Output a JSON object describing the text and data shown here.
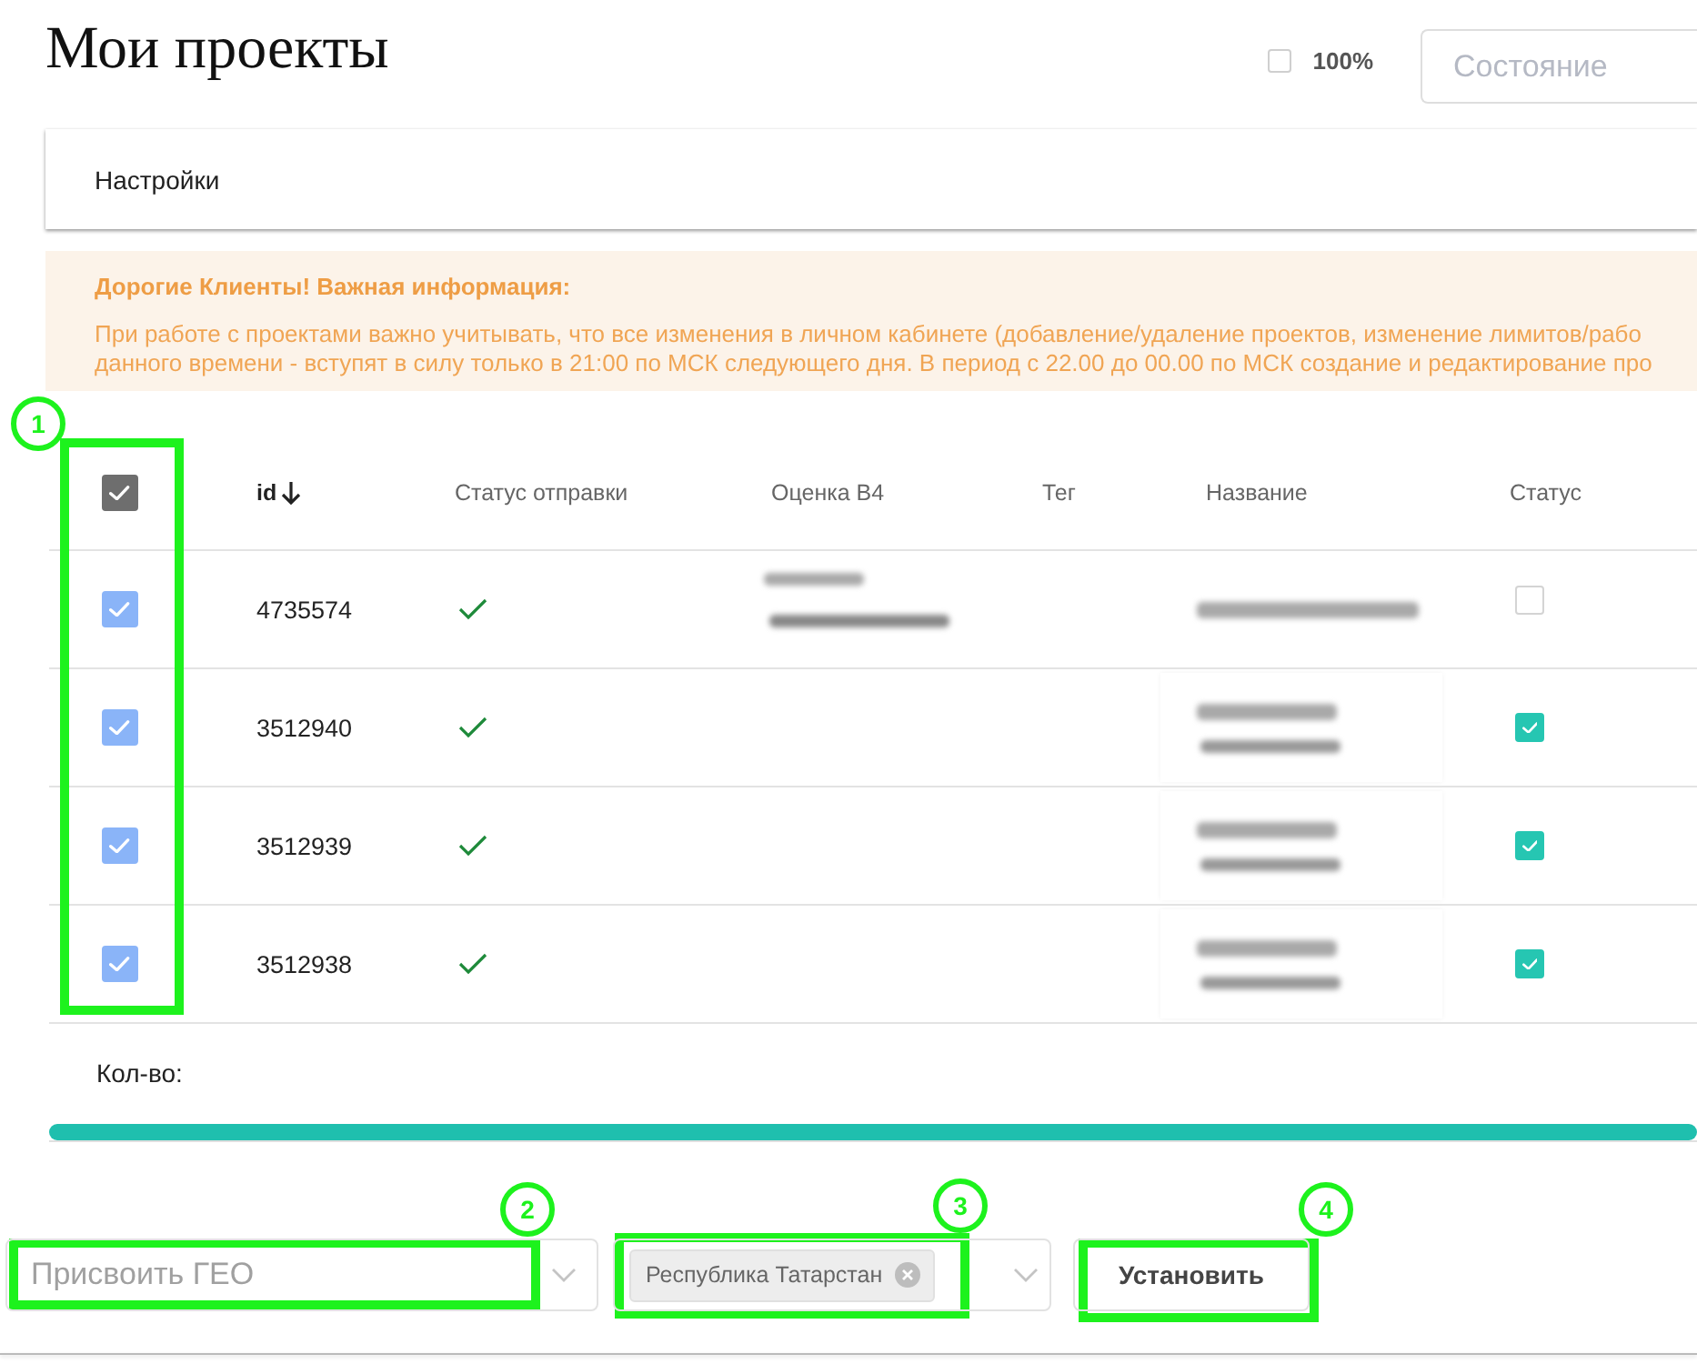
{
  "page": {
    "title": "Мои проекты"
  },
  "toolbar": {
    "full_percent": {
      "label": "100%",
      "checked": false
    },
    "state_select": {
      "placeholder": "Состояние"
    }
  },
  "settings_panel": {
    "title": "Настройки"
  },
  "notice": {
    "title": "Дорогие Клиенты! Важная информация:",
    "lines": [
      "При работе с проектами важно учитывать, что все изменения в личном кабинете (добавление/удаление проектов, изменение лимитов/рабо",
      "данного времени - вступят в силу только в 21:00 по МСК следующего дня. В период с 22.00 до 00.00 по МСК создание и редактирование про"
    ]
  },
  "table": {
    "callout": "1",
    "select_all": {
      "checked": true
    },
    "columns": [
      {
        "label": "id",
        "sorted": true
      },
      {
        "label": "Статус отправки",
        "sorted": false
      },
      {
        "label": "Оценка В4",
        "sorted": false
      },
      {
        "label": "Тег",
        "sorted": false
      },
      {
        "label": "Название",
        "sorted": false
      },
      {
        "label": "Статус",
        "sorted": false
      }
    ],
    "rows": [
      {
        "kind": "rated",
        "selected": true,
        "id": "4735574",
        "sent": true,
        "active": false
      },
      {
        "kind": "unrated",
        "selected": true,
        "id": "3512940",
        "sent": true,
        "active": true
      },
      {
        "kind": "unrated",
        "selected": true,
        "id": "3512939",
        "sent": true,
        "active": true
      },
      {
        "kind": "unrated",
        "selected": true,
        "id": "3512938",
        "sent": true,
        "active": true
      }
    ]
  },
  "summary": {
    "label": "Кол-во:"
  },
  "bulk_actions": {
    "geo_select": {
      "placeholder": "Присвоить ГЕО",
      "callout": "2"
    },
    "region_select": {
      "chips": [
        {
          "label": "Республика Татарстан"
        }
      ],
      "callout": "3"
    },
    "apply_button": {
      "label": "Установить",
      "callout": "4"
    }
  }
}
